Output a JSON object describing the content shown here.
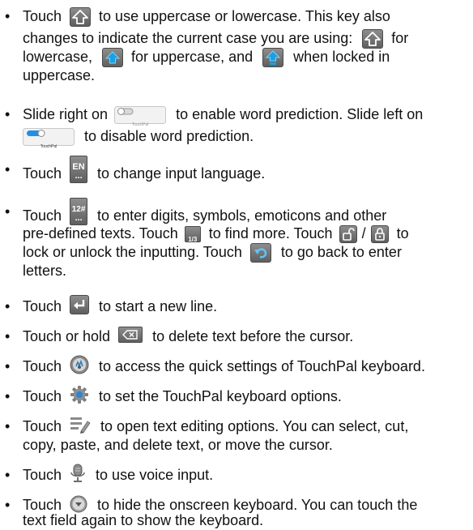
{
  "bullets": [
    {
      "lines": [
        [
          "Touch",
          "to use uppercase or lowercase. This key also"
        ],
        [
          "changes to indicate the current case you are using:",
          "for"
        ],
        [
          "lowercase,",
          "for uppercase, and",
          "when locked in"
        ],
        [
          "uppercase."
        ]
      ]
    },
    {
      "lines": [
        [
          "Slide right on",
          "to enable word prediction. Slide left on"
        ],
        [
          "",
          "to disable word prediction."
        ]
      ]
    },
    {
      "lines": [
        [
          "Touch",
          "to change input language."
        ]
      ]
    },
    {
      "lines": [
        [
          "Touch",
          "to enter digits, symbols, emoticons and other"
        ],
        [
          "pre-defined texts. Touch",
          "to find more. Touch",
          "/",
          "to"
        ],
        [
          "lock or unlock the inputting. Touch",
          "to go back to enter"
        ],
        [
          "letters."
        ]
      ]
    },
    {
      "lines": [
        [
          "Touch",
          "to start a new line."
        ]
      ]
    },
    {
      "lines": [
        [
          "Touch or hold",
          "to delete text before the cursor."
        ]
      ]
    },
    {
      "lines": [
        [
          "Touch",
          "to access the quick settings of TouchPal keyboard."
        ]
      ]
    },
    {
      "lines": [
        [
          "Touch",
          "to set the TouchPal keyboard options."
        ]
      ]
    },
    {
      "lines": [
        [
          "Touch",
          "to open text editing options. You can select, cut,"
        ],
        [
          "copy, paste, and delete text, or move the cursor."
        ]
      ]
    },
    {
      "lines": [
        [
          "Touch",
          "to use voice input."
        ]
      ]
    },
    {
      "lines": [
        [
          "Touch",
          "to hide the onscreen keyboard. You can touch the"
        ],
        [
          "text field again to show the keyboard."
        ]
      ]
    }
  ],
  "bullet_char": "•",
  "icon_text": {
    "toggle_label": "TouchPal",
    "lang_top": "EN",
    "lang_bottom": "...",
    "sym_top": "12#",
    "sym_bottom": "...",
    "page": "1/3"
  },
  "icons": {
    "shift": "shift-key-icon",
    "shift_lower": "shift-lowercase-icon",
    "shift_upper": "shift-uppercase-icon",
    "shift_locked": "shift-locked-icon",
    "toggle_off": "prediction-toggle-off-icon",
    "toggle_on": "prediction-toggle-on-icon",
    "language": "language-key-icon",
    "symbols": "symbol-key-icon",
    "page": "page-indicator-icon",
    "unlock": "unlock-icon",
    "lock": "lock-icon",
    "back": "back-arrow-icon",
    "enter": "enter-key-icon",
    "delete": "delete-key-icon",
    "quick_settings": "quick-settings-icon",
    "settings": "settings-gear-icon",
    "edit": "text-edit-icon",
    "voice": "microphone-icon",
    "hide": "hide-keyboard-icon"
  },
  "colors": {
    "text": "#111111",
    "key_grey": "#7a7a7a",
    "key_blue": "#1aa0e0",
    "toggle_blue": "#1e90e8"
  }
}
